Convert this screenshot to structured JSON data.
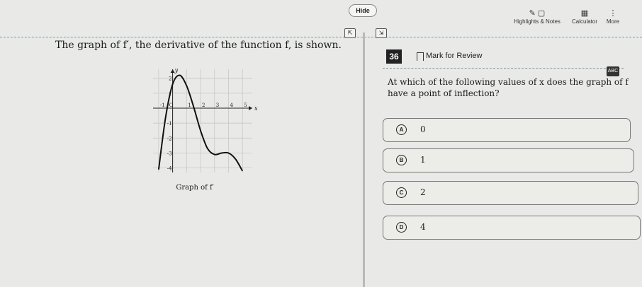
{
  "toolbar": {
    "hide_label": "Hide",
    "highlights_notes_label": "Highlights & Notes",
    "calculator_label": "Calculator",
    "more_label": "More"
  },
  "left": {
    "prompt": "The graph of f′, the derivative of the function f, is shown.",
    "graph_caption": "Graph of f′",
    "axis_x_label": "x",
    "axis_y_label": "y",
    "x_ticks": [
      "-1",
      "O",
      "1",
      "2",
      "3",
      "4",
      "5"
    ],
    "y_ticks": [
      "2",
      "1",
      "-1",
      "-2",
      "-3",
      "-4"
    ]
  },
  "question": {
    "number": "36",
    "mark_for_review": "Mark for Review",
    "strike_badge": "ABC",
    "text": "At which of the following values of x does the graph of f have a point of inflection?",
    "choices": [
      {
        "letter": "A",
        "value": "0"
      },
      {
        "letter": "B",
        "value": "1"
      },
      {
        "letter": "C",
        "value": "2"
      },
      {
        "letter": "D",
        "value": "4"
      }
    ]
  },
  "chart_data": {
    "type": "line",
    "title": "Graph of f′",
    "xlabel": "x",
    "ylabel": "y",
    "xlim": [
      -1.4,
      5.7
    ],
    "ylim": [
      -4.3,
      2.6
    ],
    "grid": true,
    "series": [
      {
        "x": [
          -1,
          -0.5,
          0,
          0.5,
          1,
          1.5,
          2,
          2.5,
          3,
          3.5,
          4,
          4.5,
          5
        ],
        "y": [
          -4.1,
          -0.6,
          1.6,
          2.2,
          1.5,
          0.1,
          -1.5,
          -2.7,
          -3.1,
          -3.0,
          -3.0,
          -3.4,
          -4.2
        ]
      }
    ]
  }
}
